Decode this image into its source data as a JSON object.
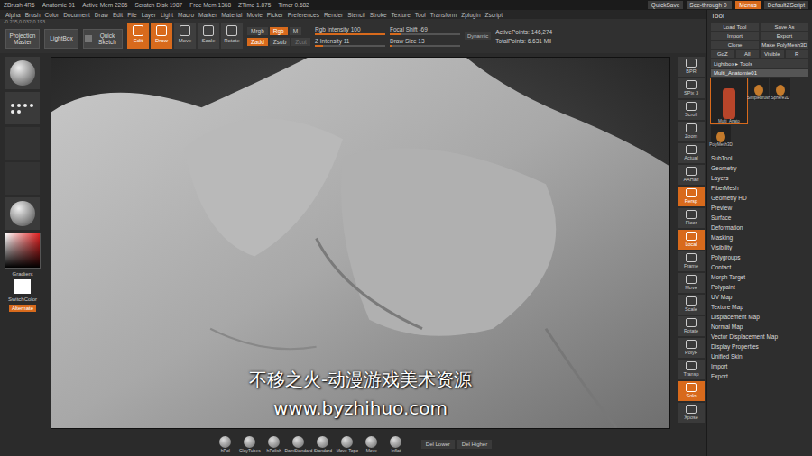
{
  "top_bar": {
    "left": [
      "ZBrush 4R6",
      "Anatomie 01",
      "Active Mem 2285",
      "Scratch Disk 1987",
      "Free Mem 1368",
      "ZTime 1.875",
      "Timer 0.682"
    ],
    "right": [
      {
        "label": "QuickSave",
        "kind": "button",
        "on": false
      },
      {
        "label": "See-through 0",
        "kind": "slider",
        "level": 0
      },
      {
        "label": "Menus",
        "kind": "toggle",
        "on": true
      },
      {
        "label": "DefaultZScript",
        "kind": "button",
        "on": false
      }
    ]
  },
  "menu": [
    "Alpha",
    "Brush",
    "Color",
    "Document",
    "Draw",
    "Edit",
    "File",
    "Layer",
    "Light",
    "Macro",
    "Marker",
    "Material",
    "Movie",
    "Picker",
    "Preferences",
    "Render",
    "Stencil",
    "Stroke",
    "Texture",
    "Tool",
    "Transform",
    "Zplugin",
    "Zscript"
  ],
  "coords": "-0.235,0.032,0.193",
  "toolbar": {
    "big_buttons": [
      "Projection Master",
      "LightBox"
    ],
    "quick_sketch": "Quick Sketch",
    "modes": [
      {
        "label": "Edit",
        "selected": true
      },
      {
        "label": "Draw",
        "selected": true
      },
      {
        "label": "Move",
        "selected": false
      },
      {
        "label": "Scale",
        "selected": false
      },
      {
        "label": "Rotate",
        "selected": false
      }
    ],
    "channels_rgb": [
      {
        "label": "Mrgb",
        "selected": false
      },
      {
        "label": "Rgb",
        "selected": true
      },
      {
        "label": "M",
        "selected": false
      }
    ],
    "channels_z": [
      {
        "label": "Zadd",
        "selected": true,
        "disabled": false
      },
      {
        "label": "Zsub",
        "selected": false,
        "disabled": false
      },
      {
        "label": "Zcut",
        "selected": false,
        "disabled": true
      }
    ],
    "sliders_left": [
      {
        "label": "Rgb Intensity",
        "value": "100",
        "level": 1
      },
      {
        "label": "Z Intensity",
        "value": "11",
        "level": 0.11
      }
    ],
    "sliders_mid": [
      {
        "label": "Focal Shift",
        "value": "-69",
        "level": 0.155
      },
      {
        "label": "Draw Size",
        "value": "13",
        "level": 0.03
      }
    ],
    "dynamic": "Dynamic",
    "stats": [
      "ActivePoints: 146,274",
      "TotalPoints: 6.631 Mil"
    ]
  },
  "left_shelf": {
    "gradient": "Gradient",
    "switch": "SwitchColor",
    "alternate": {
      "label": "Alternate",
      "on": true
    }
  },
  "right_shelf": [
    {
      "label": "BPR",
      "selected": false
    },
    {
      "label": "SPix 3",
      "selected": false
    },
    {
      "label": "Scroll",
      "selected": false
    },
    {
      "label": "Zoom",
      "selected": false
    },
    {
      "label": "Actual",
      "selected": false
    },
    {
      "label": "AAHalf",
      "selected": false
    },
    {
      "label": "Persp",
      "selected": true
    },
    {
      "label": "Floor",
      "selected": false
    },
    {
      "label": "Local",
      "selected": true
    },
    {
      "label": "Frame",
      "selected": false
    },
    {
      "label": "Move",
      "selected": false
    },
    {
      "label": "Scale",
      "selected": false
    },
    {
      "label": "Rotate",
      "selected": false
    },
    {
      "label": "PolyF",
      "selected": false
    },
    {
      "label": "Transp",
      "selected": false
    },
    {
      "label": "Solo",
      "selected": true
    },
    {
      "label": "Xpose",
      "selected": false
    }
  ],
  "palette": {
    "title": "Tool",
    "buttons": [
      [
        "Load Tool",
        "Save As"
      ],
      [
        "Import",
        "Export"
      ],
      [
        "Clone",
        "Make PolyMesh3D"
      ],
      [
        "GoZ",
        "All",
        "Visible",
        "R"
      ]
    ],
    "lightbox": "Lightbox ▸ Tools",
    "current": "Multi_Anatomie01",
    "thumbs": [
      {
        "label": "Multi_Anato",
        "selected": true
      },
      {
        "label": "SimpleBrush",
        "selected": false
      },
      {
        "label": "Sphere3D",
        "selected": false
      },
      {
        "label": "PolyMesh3D",
        "selected": false
      }
    ],
    "subpalettes": [
      "SubTool",
      "Geometry",
      "Layers",
      "FiberMesh",
      "Geometry HD",
      "Preview",
      "Surface",
      "Deformation",
      "Masking",
      "Visibility",
      "Polygroups",
      "Contact",
      "Morph Target",
      "Polypaint",
      "UV Map",
      "Texture Map",
      "Displacement Map",
      "Normal Map",
      "Vector Displacement Map",
      "Display Properties",
      "Unified Skin",
      "Import",
      "Export"
    ]
  },
  "bottom": {
    "brushes": [
      "hPol",
      "ClayTubes",
      "hPolish",
      "DamStandard",
      "Standard",
      "Move Topo",
      "Move",
      "Inflat"
    ],
    "buttons": [
      "Del Lower",
      "Del Higher"
    ]
  },
  "watermark": [
    "不移之火-动漫游戏美术资源",
    "www.byzhihuo.com"
  ]
}
